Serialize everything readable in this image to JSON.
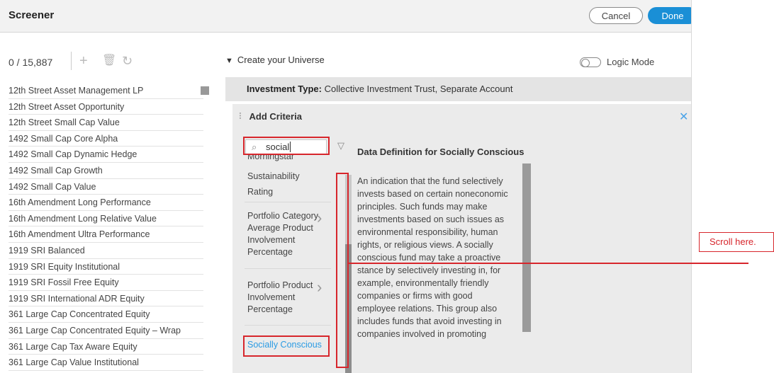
{
  "header": {
    "title": "Screener",
    "cancel_label": "Cancel",
    "done_label": "Done"
  },
  "left_panel": {
    "count": "0 / 15,887",
    "items": [
      "12th Street Asset Management LP",
      "12th Street Asset Opportunity",
      "12th Street Small Cap Value",
      "1492 Small Cap Core Alpha",
      "1492 Small Cap Dynamic Hedge",
      "1492 Small Cap Growth",
      "1492 Small Cap Value",
      "16th Amendment Long Performance",
      "16th Amendment Long Relative Value",
      "16th Amendment Ultra Performance",
      "1919 SRI Balanced",
      "1919 SRI Equity Institutional",
      "1919 SRI Fossil Free Equity",
      "1919 SRI International ADR Equity",
      "361 Large Cap Concentrated Equity",
      "361 Large Cap Concentrated Equity – Wrap",
      "361 Large Cap Tax Aware Equity",
      "361 Large Cap Value Institutional"
    ]
  },
  "universe": {
    "label": "Create your Universe",
    "logic_mode_label": "Logic Mode"
  },
  "investment_type": {
    "label": "Investment Type:",
    "value": "Collective Investment Trust, Separate Account"
  },
  "criteria": {
    "title": "Add Criteria",
    "search_value": "social",
    "results": {
      "morningstar": "Morningstar",
      "sustainability": "Sustainability",
      "rating": "Rating",
      "portfolio_category": [
        "Portfolio Category",
        "Average Product",
        "Involvement",
        "Percentage"
      ],
      "portfolio_product": [
        "Portfolio Product",
        "Involvement",
        "Percentage"
      ],
      "socially_conscious": "Socially Conscious"
    },
    "definition_title": "Data Definition for Socially Conscious",
    "definition_lines": [
      "An indication that the fund selectively",
      "invests based on certain noneconomic",
      "principles. Such funds may make",
      "investments based on such issues as",
      "environmental responsibility, human",
      "rights, or religious views. A socially",
      "conscious fund may take a proactive",
      "stance by selectively investing in, for",
      "example, environmentally friendly",
      "companies or firms with good",
      "employee relations. This group also",
      "includes funds that avoid investing in",
      "companies involved in promoting"
    ]
  },
  "callout": {
    "text": "Scroll here."
  },
  "icons": [
    "plus-icon",
    "trash-icon",
    "refresh-icon",
    "search-icon",
    "filter-icon",
    "close-icon",
    "chevron-right-icon",
    "drag-handle-icon",
    "caret-down-icon"
  ],
  "colors": {
    "accent": "#1a8fd6",
    "link": "#2b9be3",
    "highlight": "#d7262c"
  }
}
